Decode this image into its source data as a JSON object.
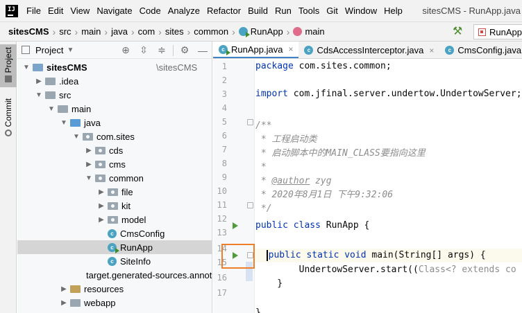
{
  "menubar": {
    "items": [
      "File",
      "Edit",
      "View",
      "Navigate",
      "Code",
      "Analyze",
      "Refactor",
      "Build",
      "Run",
      "Tools",
      "Git",
      "Window",
      "Help"
    ],
    "window_title": "sitesCMS - RunApp.java"
  },
  "navbar": {
    "crumbs": [
      "sitesCMS",
      "src",
      "main",
      "java",
      "com",
      "sites",
      "common",
      "RunApp",
      "main"
    ],
    "run_config": "RunApp"
  },
  "toolstrip": {
    "project": "Project",
    "commit": "Commit"
  },
  "project_panel": {
    "title": "Project",
    "tree": [
      {
        "label": "sitesCMS",
        "path": "\\sitesCMS"
      },
      {
        "label": ".idea"
      },
      {
        "label": "src"
      },
      {
        "label": "main"
      },
      {
        "label": "java"
      },
      {
        "label": "com.sites"
      },
      {
        "label": "cds"
      },
      {
        "label": "cms"
      },
      {
        "label": "common"
      },
      {
        "label": "file"
      },
      {
        "label": "kit"
      },
      {
        "label": "model"
      },
      {
        "label": "CmsConfig"
      },
      {
        "label": "RunApp"
      },
      {
        "label": "SiteInfo"
      },
      {
        "label": "target.generated-sources.annotations"
      },
      {
        "label": "resources"
      },
      {
        "label": "webapp"
      }
    ]
  },
  "editor": {
    "tabs": [
      "RunApp.java",
      "CdsAccessInterceptor.java",
      "CmsConfig.java"
    ],
    "line_numbers": [
      "1",
      "2",
      "3",
      "4",
      "5",
      "6",
      "7",
      "8",
      "9",
      "10",
      "11",
      "12",
      "13",
      "14",
      "15",
      "16",
      "17"
    ],
    "code": {
      "l1_kw": "package",
      "l1_rest": " com.sites.common;",
      "l3_kw": "import",
      "l3_rest": " com.jfinal.server.undertow.UndertowServer;",
      "l5": "/**",
      "l6": " * 工程启动类",
      "l7": " * 启动脚本中的MAIN_CLASS要指向这里",
      "l8": " *",
      "l9_pre": " * ",
      "l9_tag": "@author",
      "l9_post": " zyg",
      "l10": " * 2020年8月1日 下午9:32:06",
      "l11": " */",
      "l12_kw": "public class",
      "l12_rest": " RunApp {",
      "l14_kw": "public static void",
      "l14_rest": " main(String[] args) {",
      "l15_pre": "        UndertowServer.start((",
      "l15_hint": "Class<? extends co",
      "l16": "    }",
      "l17": "}"
    }
  },
  "colors": {
    "keyword": "#0033b3",
    "comment": "#8c8c8c",
    "tab_accent": "#4083c9",
    "highlight": "#f07d28"
  }
}
